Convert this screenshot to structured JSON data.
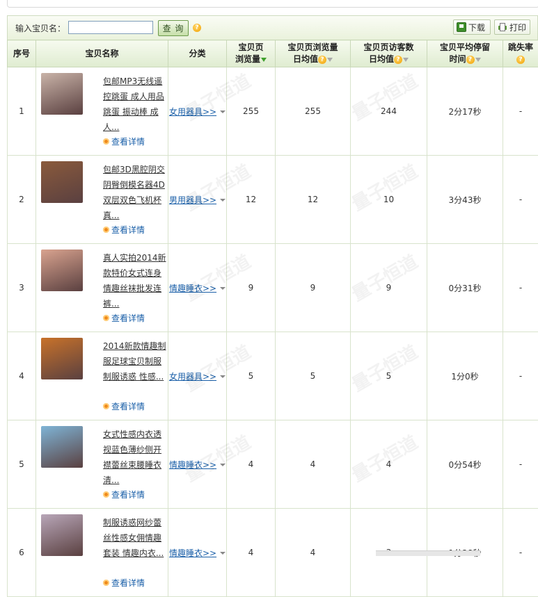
{
  "toolbar": {
    "search_label": "输入宝贝名：",
    "search_value": "",
    "query_label": "查 询",
    "help_icon": "question-icon",
    "download_label": "下载",
    "print_label": "打印"
  },
  "table": {
    "columns": [
      {
        "label": "序号"
      },
      {
        "label": "宝贝名称"
      },
      {
        "label": "分类"
      },
      {
        "label": "宝贝页浏览量",
        "sort": "desc-active"
      },
      {
        "label": "宝贝页浏览量日均值",
        "sort": "inactive"
      },
      {
        "label": "宝贝页访客数日均值",
        "sort": "inactive"
      },
      {
        "label": "宝贝平均停留时间",
        "sort": "inactive"
      },
      {
        "label": "跳失率"
      }
    ],
    "detail_label": "查看详情",
    "rows": [
      {
        "index": "1",
        "title": "包邮MP3无线遥控跳蛋 成人用品跳蛋 振动棒 成人...",
        "category": "女用器具>>",
        "views": "255",
        "daily_views": "255",
        "daily_visitors": "244",
        "avg_stay": "2分17秒",
        "bounce": "-",
        "thumb_color": "#c9b3a8"
      },
      {
        "index": "2",
        "title": "包邮3D黑腔阴交阴臀倒模名器4D双层双色飞机杯真...",
        "category": "男用器具>>",
        "views": "12",
        "daily_views": "12",
        "daily_visitors": "10",
        "avg_stay": "3分43秒",
        "bounce": "-",
        "thumb_color": "#8a5a3c"
      },
      {
        "index": "3",
        "title": "真人实拍2014新款特价女式连身情趣丝袜批发连裤...",
        "category": "情趣睡衣>>",
        "views": "9",
        "daily_views": "9",
        "daily_visitors": "9",
        "avg_stay": "0分31秒",
        "bounce": "-",
        "thumb_color": "#d9a38f"
      },
      {
        "index": "4",
        "title": "2014新款情趣制服足球宝贝制服 制服诱惑 性感...",
        "category": "女用器具>>",
        "views": "5",
        "daily_views": "5",
        "daily_visitors": "5",
        "avg_stay": "1分0秒",
        "bounce": "-",
        "thumb_color": "#c8722a"
      },
      {
        "index": "5",
        "title": "女式性感内衣透视蓝色薄纱侧开襟蕾丝束腰睡衣 清...",
        "category": "情趣睡衣>>",
        "views": "4",
        "daily_views": "4",
        "daily_visitors": "4",
        "avg_stay": "0分54秒",
        "bounce": "-",
        "thumb_color": "#7fb4d6"
      },
      {
        "index": "6",
        "title": "制服诱惑网纱蕾丝性感女佣情趣套装 情趣内衣...",
        "category": "情趣睡衣>>",
        "views": "4",
        "daily_views": "4",
        "daily_visitors": "3",
        "avg_stay": "1分28秒",
        "bounce": "-",
        "thumb_color": "#b8a6b8"
      }
    ]
  },
  "watermark": "量子恒道"
}
